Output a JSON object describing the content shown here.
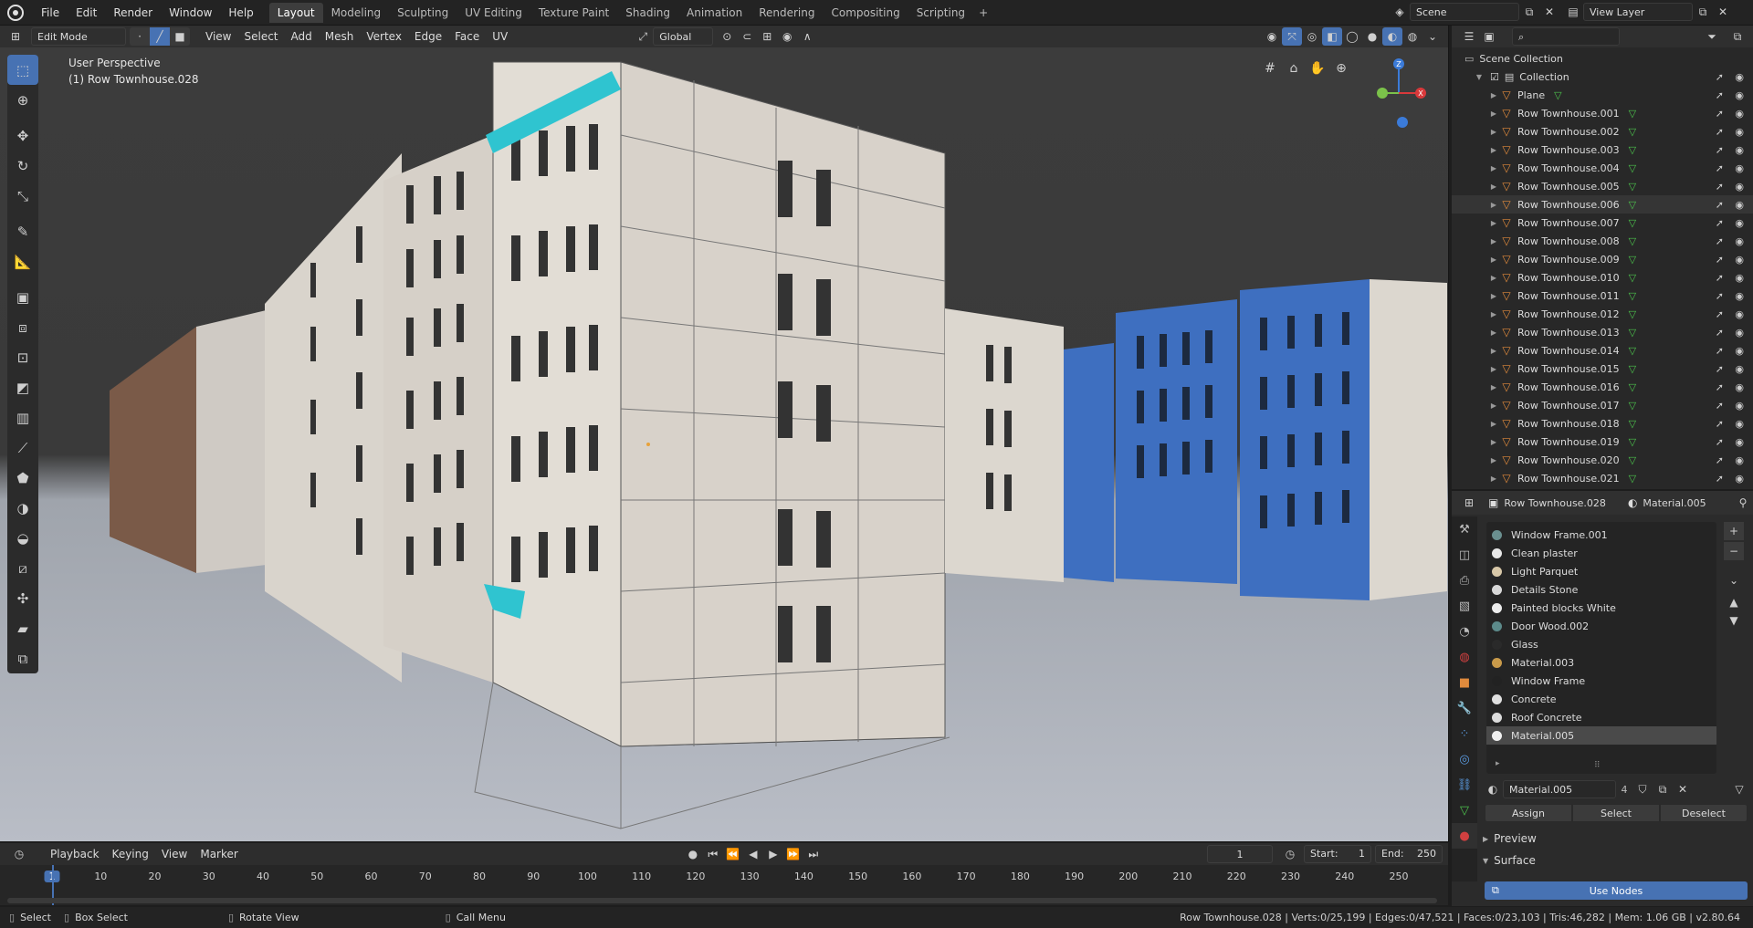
{
  "topbar": {
    "menus": [
      "File",
      "Edit",
      "Render",
      "Window",
      "Help"
    ],
    "workspaces": [
      "Layout",
      "Modeling",
      "Sculpting",
      "UV Editing",
      "Texture Paint",
      "Shading",
      "Animation",
      "Rendering",
      "Compositing",
      "Scripting"
    ],
    "active_workspace": "Layout",
    "scene": "Scene",
    "view_layer": "View Layer"
  },
  "viewport": {
    "mode": "Edit Mode",
    "menus": [
      "View",
      "Select",
      "Add",
      "Mesh",
      "Vertex",
      "Edge",
      "Face",
      "UV"
    ],
    "orientation": "Global",
    "perspective_label": "User Perspective",
    "object_label": "(1) Row Townhouse.028",
    "gizmo_axes": {
      "x": "X",
      "y": "Y",
      "z": "Z"
    }
  },
  "outliner": {
    "scene_collection": "Scene Collection",
    "collection": "Collection",
    "search_placeholder": "",
    "items": [
      "Plane",
      "Row Townhouse.001",
      "Row Townhouse.002",
      "Row Townhouse.003",
      "Row Townhouse.004",
      "Row Townhouse.005",
      "Row Townhouse.006",
      "Row Townhouse.007",
      "Row Townhouse.008",
      "Row Townhouse.009",
      "Row Townhouse.010",
      "Row Townhouse.011",
      "Row Townhouse.012",
      "Row Townhouse.013",
      "Row Townhouse.014",
      "Row Townhouse.015",
      "Row Townhouse.016",
      "Row Townhouse.017",
      "Row Townhouse.018",
      "Row Townhouse.019",
      "Row Townhouse.020",
      "Row Townhouse.021"
    ],
    "selected_item": "Row Townhouse.006"
  },
  "properties": {
    "object": "Row Townhouse.028",
    "material": "Material.005",
    "materials": [
      "Window Frame.001",
      "Clean plaster",
      "Light Parquet",
      "Details Stone",
      "Painted blocks White",
      "Door Wood.002",
      "Glass",
      "Material.003",
      "Window Frame",
      "Concrete",
      "Roof Concrete",
      "Material.005"
    ],
    "material_colors": [
      "#6a8f8f",
      "#e8e8e8",
      "#d8c8a8",
      "#d8d8d8",
      "#ececec",
      "#5c8a8a",
      "#2a2a2a",
      "#c89a4a",
      "#222222",
      "#e0e0e0",
      "#dcdcdc",
      "#f0f0f0"
    ],
    "selected_material": "Material.005",
    "material_field": "Material.005",
    "users": "4",
    "assign": "Assign",
    "select": "Select",
    "deselect": "Deselect",
    "preview": "Preview",
    "surface": "Surface",
    "use_nodes": "Use Nodes"
  },
  "timeline": {
    "menus": [
      "Playback",
      "Keying",
      "View",
      "Marker"
    ],
    "current_frame": "1",
    "start_label": "Start:",
    "start": "1",
    "end_label": "End:",
    "end": "250",
    "ticks": [
      "1",
      "10",
      "20",
      "30",
      "40",
      "50",
      "60",
      "70",
      "80",
      "90",
      "100",
      "110",
      "120",
      "130",
      "140",
      "150",
      "160",
      "170",
      "180",
      "190",
      "200",
      "210",
      "220",
      "230",
      "240",
      "250"
    ]
  },
  "statusbar": {
    "select": "Select",
    "box_select": "Box Select",
    "rotate": "Rotate View",
    "call_menu": "Call Menu",
    "stats": "Row Townhouse.028 | Verts:0/25,199 | Edges:0/47,521 | Faces:0/23,103 | Tris:46,282 | Mem: 1.06 GB | v2.80.64"
  },
  "colors": {
    "accent": "#4772b3",
    "selected_blue": "#3e6fc0",
    "highlight_cyan": "#2fc4d0"
  }
}
